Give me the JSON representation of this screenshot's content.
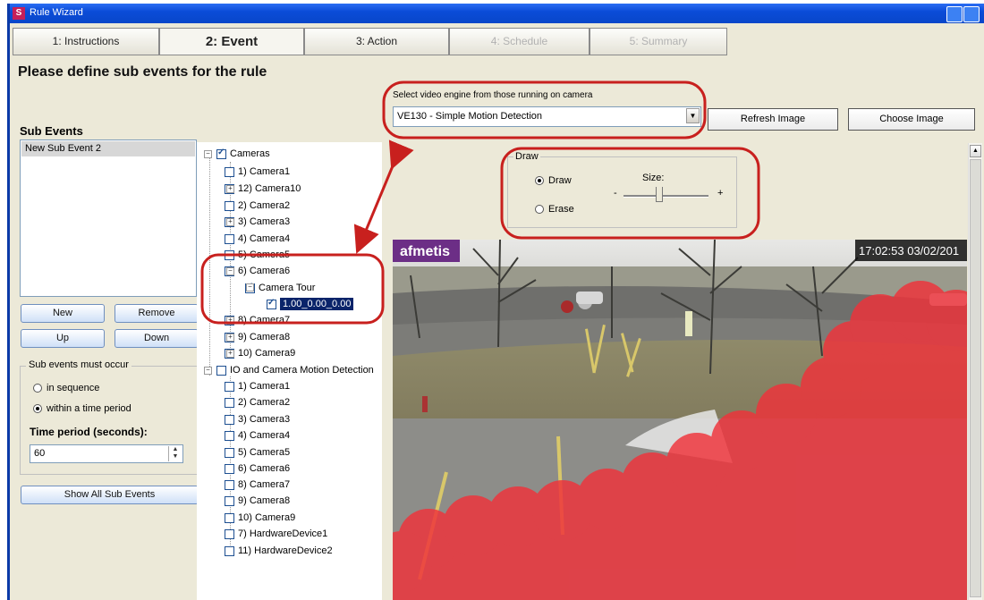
{
  "window": {
    "title": "Rule Wizard",
    "app_icon_letter": "S"
  },
  "tabs": [
    {
      "label": "1: Instructions",
      "state": "normal"
    },
    {
      "label": "2: Event",
      "state": "active"
    },
    {
      "label": "3: Action",
      "state": "normal"
    },
    {
      "label": "4: Schedule",
      "state": "disabled"
    },
    {
      "label": "5: Summary",
      "state": "disabled"
    }
  ],
  "heading": "Please define sub events for the rule",
  "sub_events": {
    "title": "Sub Events",
    "items": [
      "New Sub Event 2"
    ],
    "buttons": {
      "new": "New",
      "remove": "Remove",
      "up": "Up",
      "down": "Down"
    },
    "occur_group": {
      "legend": "Sub events must occur",
      "options": [
        "in sequence",
        "within a time period"
      ],
      "selected": "within a time period",
      "time_label": "Time period (seconds):",
      "time_value": "60"
    },
    "show_all": "Show All Sub Events"
  },
  "tree": {
    "cameras_root": "Cameras",
    "cameras": [
      {
        "label": "1) Camera1",
        "checked": false,
        "expandable": false
      },
      {
        "label": "12) Camera10",
        "checked": false,
        "expandable": true
      },
      {
        "label": "2) Camera2",
        "checked": false,
        "expandable": false
      },
      {
        "label": "3) Camera3",
        "checked": false,
        "expandable": true
      },
      {
        "label": "4) Camera4",
        "checked": false,
        "expandable": false
      },
      {
        "label": "5) Camera5",
        "checked": false,
        "expandable": false
      },
      {
        "label": "6) Camera6",
        "checked": true,
        "expandable": true
      },
      {
        "label": "Camera Tour",
        "checked": true,
        "expandable": true
      },
      {
        "label": "1.00_0.00_0.00",
        "checked": true,
        "expandable": false
      },
      {
        "label": "8) Camera7",
        "checked": false,
        "expandable": true
      },
      {
        "label": "9) Camera8",
        "checked": false,
        "expandable": true
      },
      {
        "label": "10) Camera9",
        "checked": false,
        "expandable": true
      }
    ],
    "io_root": "IO and Camera Motion Detection",
    "io_items": [
      "1) Camera1",
      "2) Camera2",
      "3) Camera3",
      "4) Camera4",
      "5) Camera5",
      "6) Camera6",
      "8) Camera7",
      "9) Camera8",
      "10) Camera9",
      "7) HardwareDevice1",
      "11) HardwareDevice2"
    ]
  },
  "engine": {
    "label": "Select video engine from those running on camera",
    "selected": "VE130 - Simple Motion Detection",
    "refresh_button": "Refresh Image",
    "choose_button": "Choose Image"
  },
  "draw_panel": {
    "legend": "Draw",
    "options": [
      "Draw",
      "Erase"
    ],
    "selected": "Draw",
    "size_label": "Size:",
    "minus": "-",
    "plus": "+",
    "size_level": 0.42
  },
  "camera": {
    "logo": "afmetis",
    "timestamp": "17:02:53 03/02/201"
  },
  "colors": {
    "annotation": "#c8201e",
    "mask": "#f0323a",
    "selection": "#0a246a"
  }
}
